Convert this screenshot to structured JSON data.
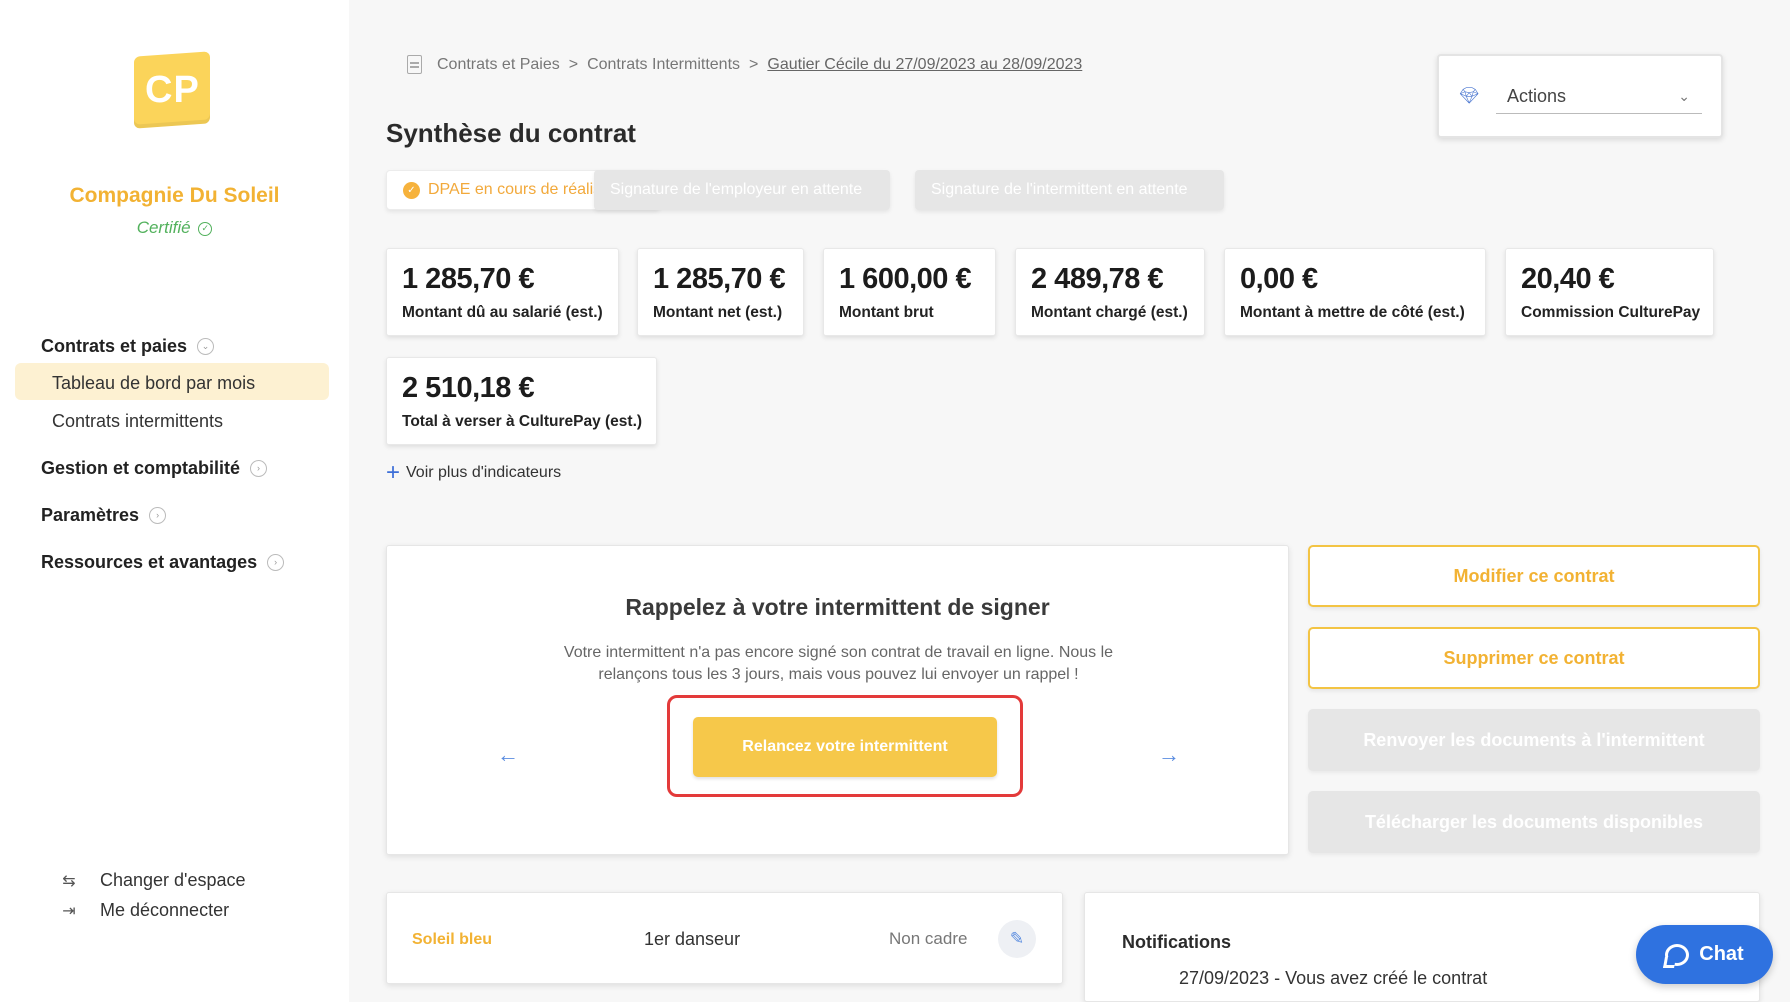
{
  "sidebar": {
    "logo_text": "CP",
    "company_name": "Compagnie Du Soleil",
    "certified_label": "Certifié",
    "nav": {
      "contracts_section": "Contrats et paies",
      "dashboard_item": "Tableau de bord par mois",
      "intermittent_item": "Contrats intermittents",
      "management_section": "Gestion et comptabilité",
      "settings_section": "Paramètres",
      "resources_section": "Ressources et avantages"
    },
    "footer": {
      "switch_space": "Changer d'espace",
      "logout": "Me déconnecter"
    }
  },
  "breadcrumb": {
    "item1": "Contrats et Paies",
    "sep": ">",
    "item2": "Contrats Intermittents",
    "item3": "Gautier Cécile du 27/09/2023 au 28/09/2023"
  },
  "page_title": "Synthèse du contrat",
  "actions": {
    "label": "Actions"
  },
  "statuses": {
    "dpae": "DPAE en cours de réalisation",
    "employer_signature": "Signature de l'employeur en attente",
    "intermittent_signature": "Signature de l'intermittent en attente"
  },
  "indicators": [
    {
      "amount": "1 285,70 €",
      "label": "Montant dû au salarié (est.)"
    },
    {
      "amount": "1 285,70 €",
      "label": "Montant net (est.)"
    },
    {
      "amount": "1 600,00 €",
      "label": "Montant brut"
    },
    {
      "amount": "2 489,78 €",
      "label": "Montant chargé (est.)"
    },
    {
      "amount": "0,00 €",
      "label": "Montant à mettre de côté (est.)"
    },
    {
      "amount": "20,40 €",
      "label": "Commission CulturePay"
    },
    {
      "amount": "2 510,18 €",
      "label": "Total à verser à CulturePay (est.)"
    }
  ],
  "more_indicators": "Voir plus d'indicateurs",
  "reminder": {
    "title": "Rappelez à votre intermittent de signer",
    "text": "Votre intermittent n'a pas encore signé son contrat de travail en ligne. Nous le relançons tous les 3 jours, mais vous pouvez lui envoyer un rappel !",
    "button": "Relancez votre intermittent",
    "prev": "←",
    "next": "→"
  },
  "side_actions": {
    "modify": "Modifier ce contrat",
    "delete": "Supprimer ce contrat",
    "resend": "Renvoyer les documents à l'intermittent",
    "download": "Télécharger les documents disponibles"
  },
  "role": {
    "project": "Soleil bleu",
    "position": "1er danseur",
    "status": "Non cadre"
  },
  "notifications": {
    "title": "Notifications",
    "items": [
      "27/09/2023 - Vous avez créé le contrat"
    ]
  },
  "chat": {
    "label": "Chat"
  },
  "colors": {
    "accent_yellow": "#f6c84a",
    "accent_orange": "#f2b233",
    "certified_green": "#52b15c",
    "chat_blue": "#2f72e0",
    "highlight_red": "#e33a3a"
  }
}
